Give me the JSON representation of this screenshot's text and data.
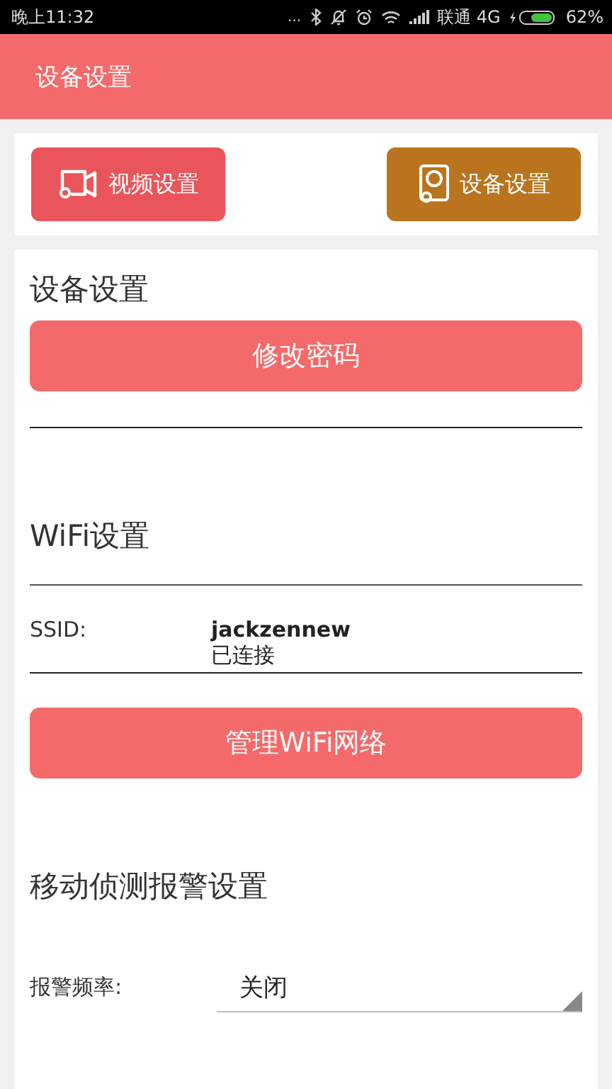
{
  "status_bar": {
    "time": "晚上11:32",
    "dots": "...",
    "carrier": "联通 4G",
    "battery": "62%"
  },
  "app_bar": {
    "title": "设备设置"
  },
  "tabs": [
    {
      "label": "视频设置",
      "selected": false,
      "kind": "video"
    },
    {
      "label": "设备设置",
      "selected": true,
      "kind": "device"
    }
  ],
  "device_section": {
    "title": "设备设置",
    "button": "修改密码"
  },
  "wifi_section": {
    "title": "WiFi设置",
    "ssid_label": "SSID:",
    "ssid": "jackzennew",
    "status": "已连接",
    "button": "管理WiFi网络"
  },
  "motion_section": {
    "title": "移动侦测报警设置",
    "frequency_label": "报警频率:",
    "frequency_value": "关闭"
  }
}
